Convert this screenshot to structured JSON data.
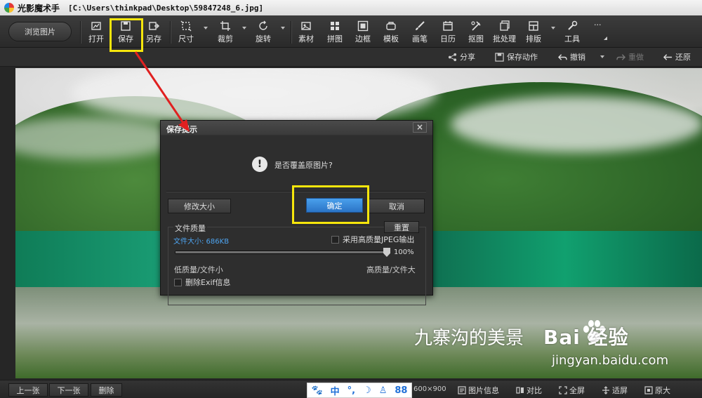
{
  "window": {
    "app_name": "光影魔术手",
    "file_path": "[C:\\Users\\thinkpad\\Desktop\\59847248_6.jpg]"
  },
  "toolbar": {
    "browse_label": "浏览图片",
    "items": [
      {
        "label": "打开",
        "icon": "open-icon"
      },
      {
        "label": "保存",
        "icon": "save-icon"
      },
      {
        "label": "另存",
        "icon": "save-as-icon"
      },
      {
        "label": "尺寸",
        "icon": "resize-icon"
      },
      {
        "label": "裁剪",
        "icon": "crop-icon"
      },
      {
        "label": "旋转",
        "icon": "rotate-icon"
      },
      {
        "label": "素材",
        "icon": "material-icon"
      },
      {
        "label": "拼图",
        "icon": "collage-icon"
      },
      {
        "label": "边框",
        "icon": "border-icon"
      },
      {
        "label": "模板",
        "icon": "template-icon"
      },
      {
        "label": "画笔",
        "icon": "brush-icon"
      },
      {
        "label": "日历",
        "icon": "calendar-icon"
      },
      {
        "label": "抠图",
        "icon": "cutout-icon"
      },
      {
        "label": "批处理",
        "icon": "batch-icon"
      },
      {
        "label": "排版",
        "icon": "layout-icon"
      },
      {
        "label": "工具",
        "icon": "tools-icon"
      },
      {
        "label": "···",
        "icon": "more-icon"
      }
    ]
  },
  "actions": {
    "share": "分享",
    "save_action": "保存动作",
    "undo": "撤销",
    "redo": "重做",
    "restore": "还原"
  },
  "photo": {
    "caption": "九寨沟的美景",
    "watermark_brand": "Bai 经验",
    "watermark_url": "jingyan.baidu.com"
  },
  "dialog": {
    "title": "保存提示",
    "close": "×",
    "message": "是否覆盖原图片?",
    "resize_button": "修改大小",
    "confirm_button": "确定",
    "cancel_button": "取消",
    "quality_group": "文件质量",
    "reset_button": "重置",
    "file_size": "文件大小: 686KB",
    "high_quality_jpeg": "采用高质量JPEG输出",
    "quality_percent": "100%",
    "quality_value": 1.0,
    "low_label": "低质量/文件小",
    "high_label": "高质量/文件大",
    "delete_exif": "删除Exif信息"
  },
  "statusbar": {
    "prev": "上一张",
    "next": "下一张",
    "delete": "删除",
    "ime_items": [
      "中",
      "°,",
      "☽",
      "♙",
      "88"
    ],
    "dimensions": "600×900",
    "image_info": "图片信息",
    "compare": "对比",
    "fullscreen": "全屏",
    "fit": "适屏",
    "original": "原大"
  },
  "colors": {
    "highlight": "#f6e60c",
    "arrow": "#e02020",
    "primary_button": "#2b74c6"
  }
}
